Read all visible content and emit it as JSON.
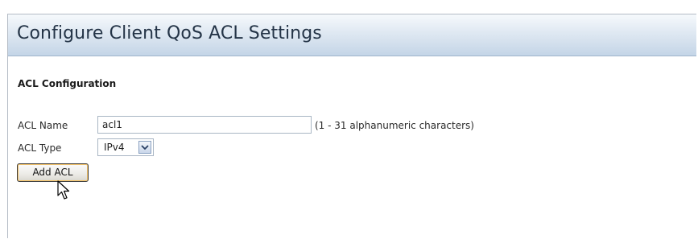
{
  "header": {
    "title": "Configure Client QoS ACL Settings"
  },
  "section": {
    "title": "ACL Configuration"
  },
  "form": {
    "acl_name_label": "ACL Name",
    "acl_name_value": "acl1",
    "acl_name_hint": "(1 - 31 alphanumeric characters)",
    "acl_type_label": "ACL Type",
    "acl_type_value": "IPv4",
    "add_button_label": "Add ACL"
  },
  "icons": {
    "select_arrow": "chevron-down-icon",
    "cursor": "mouse-pointer-icon"
  },
  "colors": {
    "banner_top": "#f6f9fc",
    "banner_bottom": "#c4d5e7",
    "title_text": "#243447",
    "button_focus": "#f4c36a"
  }
}
